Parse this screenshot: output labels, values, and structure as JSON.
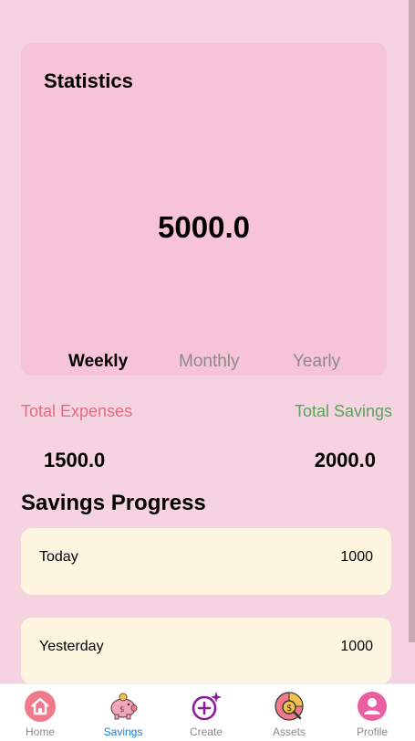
{
  "statistics": {
    "title": "Statistics",
    "total": "5000.0",
    "tabs": [
      {
        "label": "Weekly",
        "active": true
      },
      {
        "label": "Monthly",
        "active": false
      },
      {
        "label": "Yearly",
        "active": false
      }
    ]
  },
  "summary": {
    "expenses_label": "Total Expenses",
    "expenses_value": "1500.0",
    "savings_label": "Total Savings",
    "savings_value": "2000.0",
    "expenses_color": "#e46b7d",
    "savings_color": "#5aa35a"
  },
  "progress": {
    "title": "Savings Progress",
    "rows": [
      {
        "label": "Today",
        "value": "1000"
      },
      {
        "label": "Yesterday",
        "value": "1000"
      }
    ]
  },
  "nav": {
    "items": [
      {
        "label": "Home",
        "icon": "home-icon",
        "active": false
      },
      {
        "label": "Savings",
        "icon": "piggy-bank-icon",
        "active": true
      },
      {
        "label": "Create",
        "icon": "add-sparkle-icon",
        "active": false
      },
      {
        "label": "Assets",
        "icon": "coin-search-icon",
        "active": false
      },
      {
        "label": "Profile",
        "icon": "profile-icon",
        "active": false
      }
    ],
    "active_color": "#1e7bd6"
  }
}
